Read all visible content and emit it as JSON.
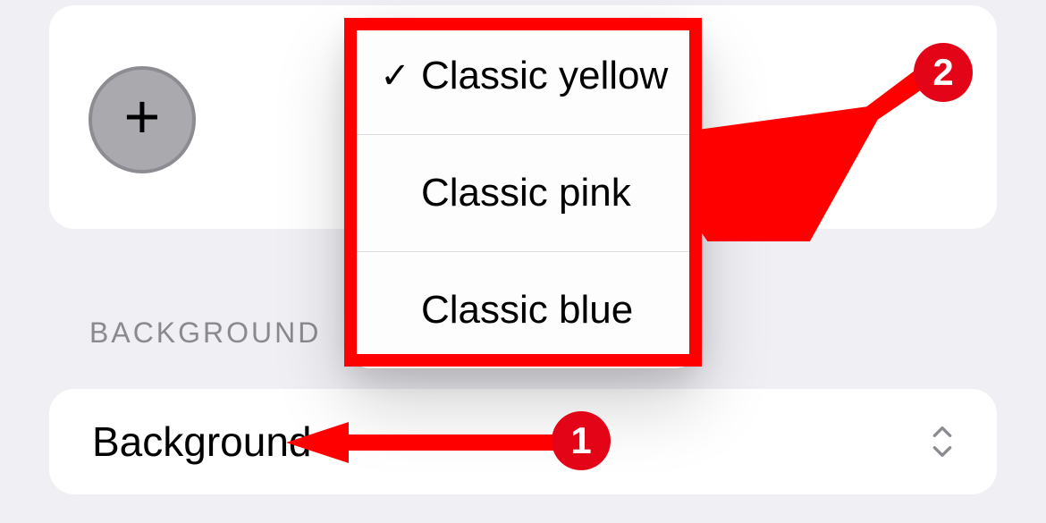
{
  "section_header": "BACKGROUND",
  "row": {
    "label": "Background"
  },
  "popup": {
    "items": [
      {
        "label": "Classic yellow",
        "selected": true
      },
      {
        "label": "Classic pink",
        "selected": false
      },
      {
        "label": "Classic blue",
        "selected": false
      }
    ]
  },
  "annotations": {
    "badge1": "1",
    "badge2": "2"
  },
  "colors": {
    "annotation_red": "#ff0000",
    "badge_red": "#e30517"
  }
}
